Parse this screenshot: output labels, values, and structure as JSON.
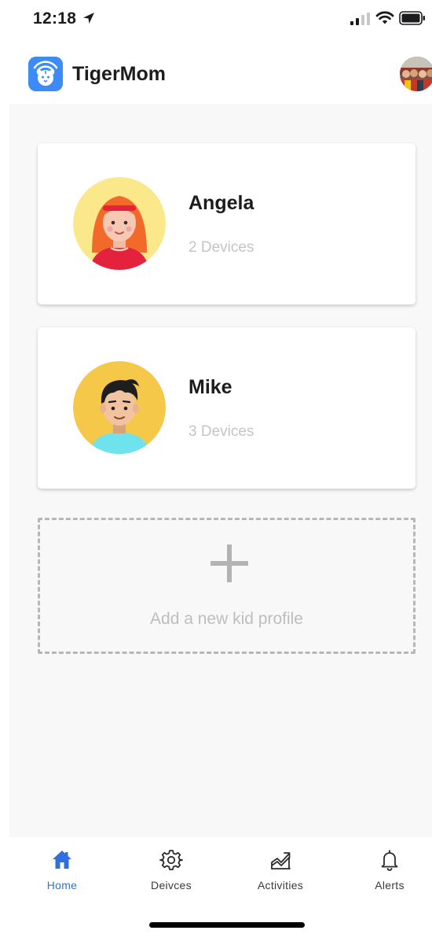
{
  "status_bar": {
    "time": "12:18"
  },
  "header": {
    "app_title": "TigerMom"
  },
  "kids": [
    {
      "name": "Angela",
      "devices": "2 Devices"
    },
    {
      "name": "Mike",
      "devices": "3 Devices"
    }
  ],
  "add_profile": {
    "label": "Add a new kid profile"
  },
  "tabs": [
    {
      "label": "Home",
      "active": true
    },
    {
      "label": "Deivces",
      "active": false
    },
    {
      "label": "Activities",
      "active": false
    },
    {
      "label": "Alerts",
      "active": false
    }
  ],
  "colors": {
    "accent": "#2f6fe0",
    "logo_bg": "#3d8bf7",
    "main_bg": "#f8f8f8",
    "muted_text": "#c4c4c4",
    "dashed_border": "#b7b7b7"
  },
  "icons": {
    "status": [
      "location-arrow-icon",
      "signal-icon",
      "wifi-icon",
      "battery-icon"
    ],
    "tabs": [
      "home-icon",
      "gear-icon",
      "chart-trend-icon",
      "bell-icon"
    ],
    "add": "plus-icon"
  }
}
